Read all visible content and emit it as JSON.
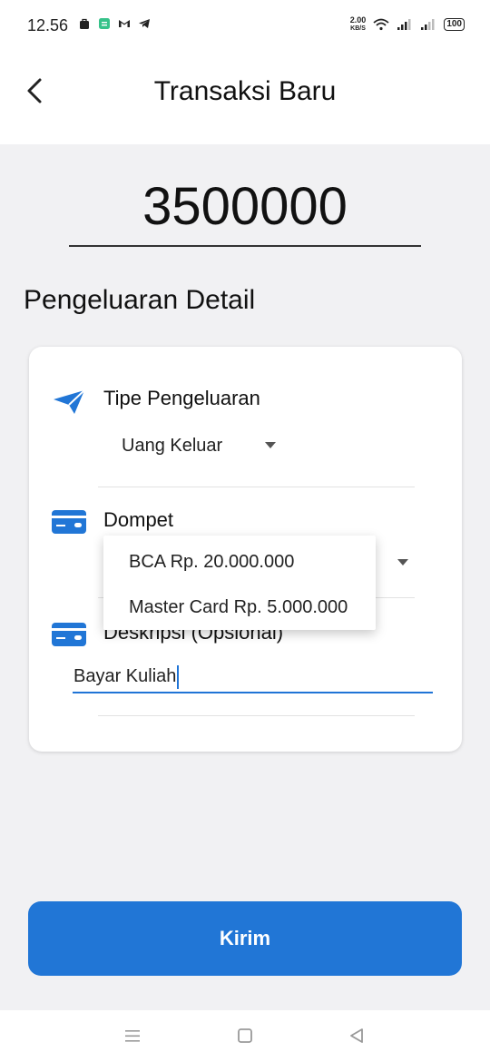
{
  "status_bar": {
    "time": "12.56",
    "net_speed_value": "2.00",
    "net_speed_unit": "KB/S",
    "battery": "100",
    "icons": [
      "bag-icon",
      "calendar-icon",
      "gmail-icon",
      "telegram-icon",
      "wifi-icon",
      "signal-icon",
      "signal-icon-2",
      "battery-icon"
    ]
  },
  "app_bar": {
    "title": "Transaksi Baru",
    "back_icon": "chevron-left-icon"
  },
  "amount": "3500000",
  "section_title": "Pengeluaran Detail",
  "form": {
    "type_field": {
      "label": "Tipe Pengeluaran",
      "value": "Uang Keluar",
      "icon": "send-icon"
    },
    "wallet_field": {
      "label": "Dompet",
      "icon": "card-icon"
    },
    "desc_field": {
      "label": "Deskripsi (Opsional)",
      "value": "Bayar Kuliah",
      "icon": "card-icon"
    }
  },
  "wallet_dropdown": {
    "options": [
      "BCA Rp. 20.000.000",
      "Master Card Rp. 5.000.000"
    ]
  },
  "submit_label": "Kirim",
  "nav_bar": {
    "icons": [
      "menu-icon",
      "home-square-icon",
      "back-triangle-icon"
    ]
  },
  "colors": {
    "accent": "#2176d6",
    "background": "#f1f1f3",
    "card": "#ffffff"
  }
}
